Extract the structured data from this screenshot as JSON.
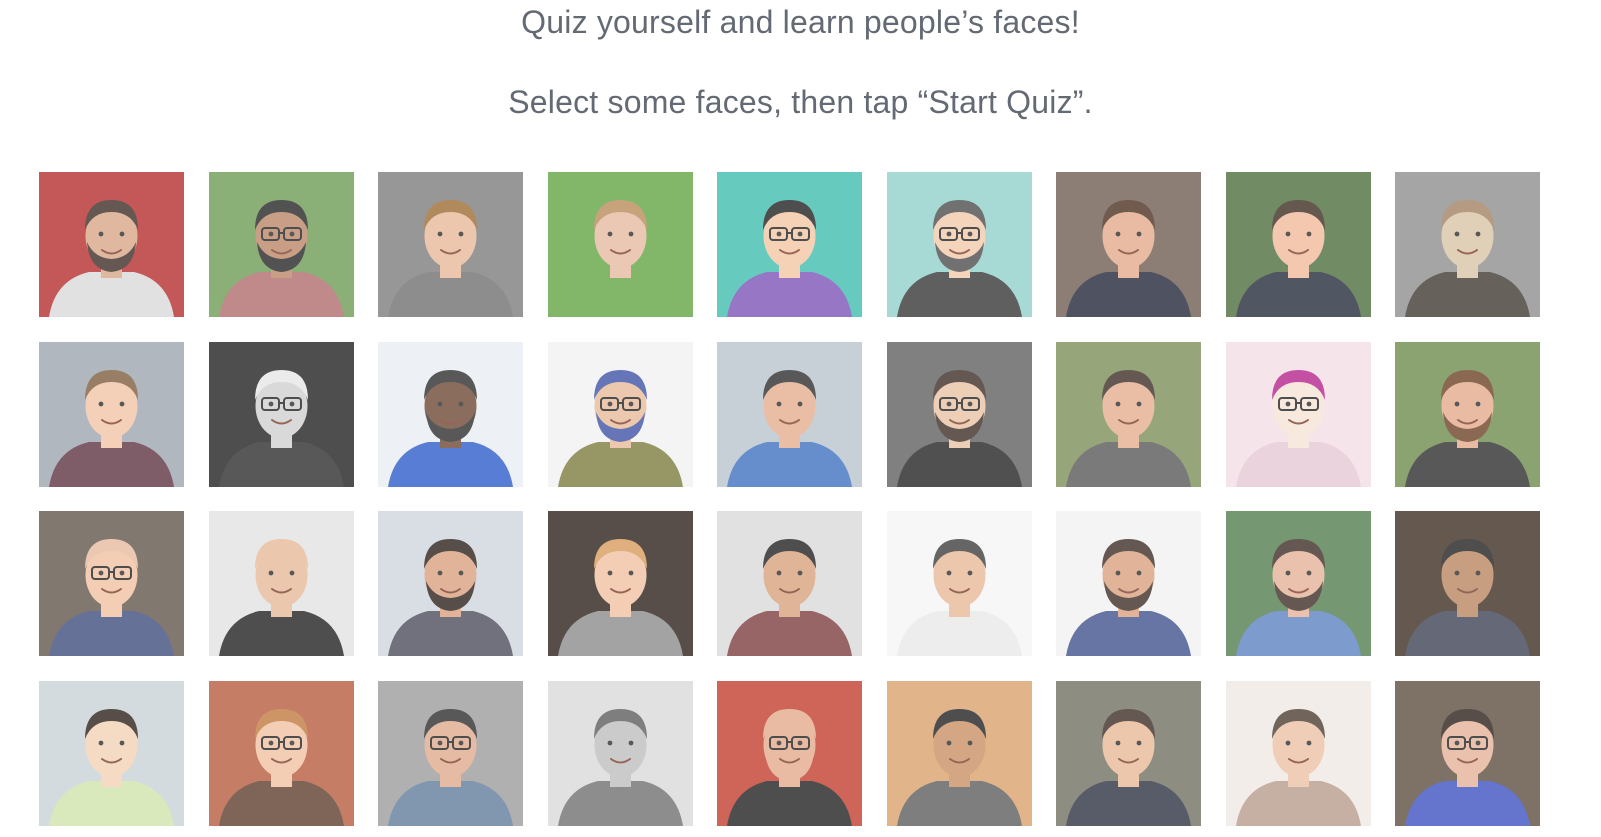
{
  "intro": {
    "line1": "Quiz yourself and learn people’s faces!",
    "line2": "Select some faces, then tap “Start Quiz”."
  },
  "faces": [
    {
      "bg": "#b4282a",
      "skin": "#d7a585",
      "hair": "#3a2a22",
      "shirt": "#d9d9d9",
      "beard": true,
      "glasses": false
    },
    {
      "bg": "#6a9a52",
      "skin": "#b98565",
      "hair": "#222222",
      "shirt": "#b06a6a",
      "beard": true,
      "glasses": true
    },
    {
      "bg": "#7b7b7b",
      "skin": "#e7b797",
      "hair": "#9a6a30",
      "shirt": "#6e6e6e",
      "beard": false,
      "glasses": false
    },
    {
      "bg": "#5fa240",
      "skin": "#e6b9a0",
      "hair": "#b78a56",
      "shirt": "#5fa240",
      "beard": false,
      "glasses": false
    },
    {
      "bg": "#3dbcae",
      "skin": "#f3c6a2",
      "hair": "#1d1d1d",
      "shirt": "#7a52b6",
      "beard": false,
      "glasses": true
    },
    {
      "bg": "#8fd0c9",
      "skin": "#f3c8aa",
      "hair": "#4a4a4a",
      "shirt": "#333333",
      "beard": true,
      "glasses": true
    },
    {
      "bg": "#6c5a4e",
      "skin": "#e3a98a",
      "hair": "#4a2e1e",
      "shirt": "#1e2235",
      "beard": false,
      "glasses": false
    },
    {
      "bg": "#4a6b3a",
      "skin": "#f0b999",
      "hair": "#3a2a1e",
      "shirt": "#202838",
      "beard": false,
      "glasses": false
    },
    {
      "bg": "#8c8c8c",
      "skin": "#d8c3a4",
      "hair": "#a08060",
      "shirt": "#3c352c",
      "beard": false,
      "glasses": false
    },
    {
      "bg": "#9aa4ad",
      "skin": "#f0c3a4",
      "hair": "#7a5a3a",
      "shirt": "#5a3040",
      "beard": false,
      "glasses": false
    },
    {
      "bg": "#1d1d1d",
      "skin": "#cfcfcf",
      "hair": "#e6e6e6",
      "shirt": "#2a2a2a",
      "beard": false,
      "glasses": true
    },
    {
      "bg": "#e9eef3",
      "skin": "#6a4530",
      "hair": "#2a2a2a",
      "shirt": "#2a59c9",
      "beard": true,
      "glasses": false
    },
    {
      "bg": "#f2f2f2",
      "skin": "#e7b999",
      "hair": "#3a4fa3",
      "shirt": "#7a7a3a",
      "beard": true,
      "glasses": true
    },
    {
      "bg": "#b9c4cc",
      "skin": "#e3ad8d",
      "hair": "#2a2a2a",
      "shirt": "#3c6fbf",
      "beard": false,
      "glasses": false
    },
    {
      "bg": "#5d5d5d",
      "skin": "#e8c1a4",
      "hair": "#3a2a22",
      "shirt": "#1f1f1f",
      "beard": true,
      "glasses": true
    },
    {
      "bg": "#7a8d55",
      "skin": "#e3ad8d",
      "hair": "#3a2a22",
      "shirt": "#555555",
      "beard": false,
      "glasses": false
    },
    {
      "bg": "#f3dde3",
      "skin": "#f6e3d6",
      "hair": "#b3208a",
      "shirt": "#e5c7d4",
      "beard": false,
      "glasses": true
    },
    {
      "bg": "#6b8a4a",
      "skin": "#e3a98a",
      "hair": "#6a3e22",
      "shirt": "#2a2a2a",
      "beard": true,
      "glasses": false
    },
    {
      "bg": "#5e5449",
      "skin": "#f0c0a0",
      "hair": "#e6b99c",
      "shirt": "#3c4a7a",
      "beard": false,
      "glasses": true
    },
    {
      "bg": "#e2e2e2",
      "skin": "#e6b897",
      "hair": "#e6b897",
      "shirt": "#1d1d1d",
      "beard": false,
      "glasses": false
    },
    {
      "bg": "#cfd6dd",
      "skin": "#d9a07e",
      "hair": "#2a1d17",
      "shirt": "#4a4a5a",
      "beard": true,
      "glasses": false
    },
    {
      "bg": "#2a1d17",
      "skin": "#f0bfa0",
      "hair": "#d79a5a",
      "shirt": "#8a8a8a",
      "beard": false,
      "glasses": false
    },
    {
      "bg": "#d9d9d9",
      "skin": "#d7a07a",
      "hair": "#1d1d1d",
      "shirt": "#7a3a3a",
      "beard": false,
      "glasses": false
    },
    {
      "bg": "#f5f5f5",
      "skin": "#e9b896",
      "hair": "#3a3a3a",
      "shirt": "#e8e8e8",
      "beard": false,
      "glasses": false
    },
    {
      "bg": "#f2f2f2",
      "skin": "#d9a07e",
      "hair": "#3a2a22",
      "shirt": "#3c4f8a",
      "beard": true,
      "glasses": false
    },
    {
      "bg": "#4f7a4a",
      "skin": "#e3b095",
      "hair": "#3a2a22",
      "shirt": "#5a7fbf",
      "beard": true,
      "glasses": false
    },
    {
      "bg": "#3a2a1e",
      "skin": "#b9845e",
      "hair": "#1d1d1d",
      "shirt": "#3a3f52",
      "beard": false,
      "glasses": false
    },
    {
      "bg": "#c7d1d7",
      "skin": "#f3d1b3",
      "hair": "#2a1d17",
      "shirt": "#cfe3a8",
      "beard": false,
      "glasses": false
    },
    {
      "bg": "#b55a3a",
      "skin": "#f0c0a0",
      "hair": "#c0783a",
      "shirt": "#5a3a2a",
      "beard": false,
      "glasses": true
    },
    {
      "bg": "#9a9a9a",
      "skin": "#e0a98a",
      "hair": "#2a2a2a",
      "shirt": "#5e7a9a",
      "beard": false,
      "glasses": true
    },
    {
      "bg": "#d9d9d9",
      "skin": "#bdbdbd",
      "hair": "#5a5a5a",
      "shirt": "#6e6e6e",
      "beard": false,
      "glasses": false
    },
    {
      "bg": "#c23b2a",
      "skin": "#e3a98a",
      "hair": "#e3a98a",
      "shirt": "#1d1d1d",
      "beard": true,
      "glasses": true
    },
    {
      "bg": "#d9a06a",
      "skin": "#c98e62",
      "hair": "#1d1d1d",
      "shirt": "#5a5a5a",
      "beard": false,
      "glasses": false
    },
    {
      "bg": "#6e6e5e",
      "skin": "#e9b896",
      "hair": "#3a2a22",
      "shirt": "#2a2f3f",
      "beard": false,
      "glasses": false
    },
    {
      "bg": "#efe8e3",
      "skin": "#ecc0a3",
      "hair": "#4a3a2e",
      "shirt": "#b59a8a",
      "beard": false,
      "glasses": false
    },
    {
      "bg": "#5a4a3a",
      "skin": "#e3b095",
      "hair": "#2a1d17",
      "shirt": "#3a4fbf",
      "beard": false,
      "glasses": true
    }
  ]
}
